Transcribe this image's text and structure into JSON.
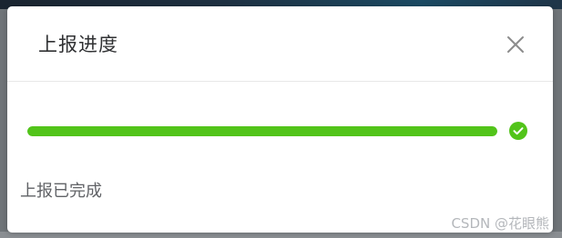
{
  "dialog": {
    "title": "上报进度",
    "close_icon": "close-icon",
    "status_text": "上报已完成"
  },
  "progress": {
    "percent": 100,
    "status": "success",
    "status_icon": "check-circle-icon"
  },
  "colors": {
    "success": "#52c41a",
    "track": "#ebeef5",
    "title": "#303133",
    "text": "#606266"
  },
  "watermark": "CSDN @花眼熊"
}
